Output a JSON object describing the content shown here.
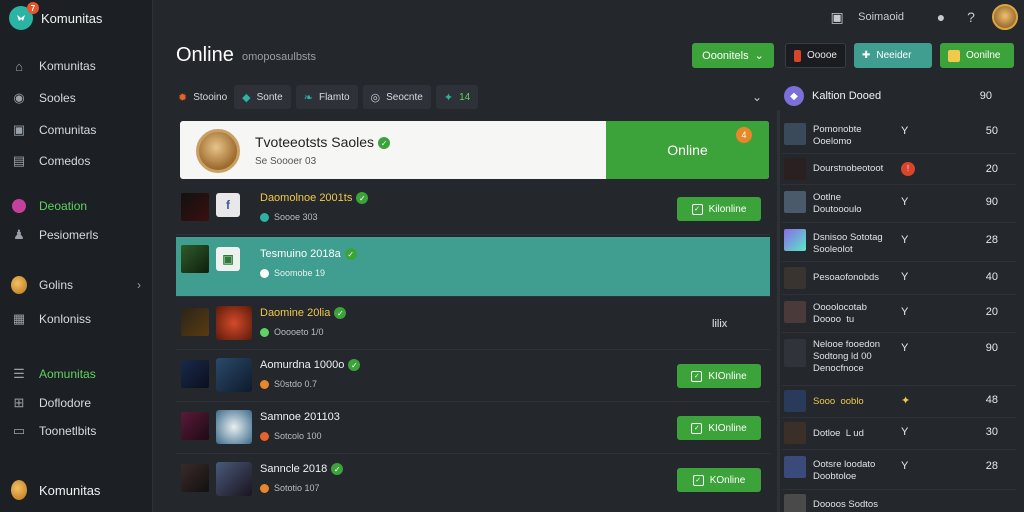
{
  "brand": {
    "name": "Komunitas",
    "badge": "7"
  },
  "sidebar": {
    "items": [
      {
        "label": "Komunitas",
        "icon": "home-icon"
      },
      {
        "label": "Sooles",
        "icon": "circle-icon"
      },
      {
        "label": "Comunitas",
        "icon": "lock-icon"
      },
      {
        "label": "Comedos",
        "icon": "blocks-icon"
      },
      {
        "label": "Deoation",
        "icon": "badge-icon"
      },
      {
        "label": "Pesiomerls",
        "icon": "user-icon"
      },
      {
        "label": "Golins",
        "icon": "avatar-icon"
      },
      {
        "label": "Konloniss",
        "icon": "chat-icon"
      },
      {
        "label": "Aomunitas",
        "icon": "list-icon"
      },
      {
        "label": "Doflodore",
        "icon": "grid-icon"
      },
      {
        "label": "Toonetlbits",
        "icon": "controller-icon"
      },
      {
        "label": "Komunitas",
        "icon": "avatar-icon"
      }
    ]
  },
  "topbar": {
    "label": "Soimaoid"
  },
  "main": {
    "title": "Online",
    "subtitle": "omoposaulbsts",
    "primary_button": "Ooonitels",
    "filters": [
      {
        "label": "Stooino",
        "icon": "flame-icon"
      },
      {
        "label": "Sonte",
        "icon": "diamond-icon"
      },
      {
        "label": "Flamto",
        "icon": "leaf-icon"
      },
      {
        "label": "Seocnte",
        "icon": "globe-icon"
      },
      {
        "label": "14",
        "icon": "sparkle-icon"
      }
    ],
    "featured": {
      "title": "Tvoteeotsts Saoles",
      "sub": "Se Soooer 03",
      "action": "Online",
      "badge": "4"
    },
    "rows": [
      {
        "name": "Daomolnoe 2001ts",
        "meta": "Soooe 303",
        "action": "Kilonline",
        "status": ""
      },
      {
        "name": "Tesmuino 2018a",
        "meta": "Soomobe 19",
        "action": "",
        "status": ""
      },
      {
        "name": "Daomine 20lia",
        "meta": "Ooooeto 1/0",
        "action": "",
        "status": "lilix"
      },
      {
        "name": "Aomurdna 1000o",
        "meta": "S0stdo 0.7",
        "action": "KIOnline",
        "status": ""
      },
      {
        "name": "Samnoe 201103",
        "meta": "Sotcolo 100",
        "action": "KIOnline",
        "status": ""
      },
      {
        "name": "Sanncle 2018",
        "meta": "Sototio 107",
        "action": "KOnline",
        "status": ""
      }
    ]
  },
  "right_panel": {
    "buttons": [
      {
        "label": "Ooooe"
      },
      {
        "label": "Neeider"
      },
      {
        "label": "Oonilne"
      }
    ],
    "header": {
      "name": "Kaltion Dooed",
      "num": "90"
    },
    "rows": [
      {
        "name": "Pomonobte\nOoelomo",
        "num": "50"
      },
      {
        "name": "Dourstnobeotoot",
        "num": "20"
      },
      {
        "name": "Ootlne\nDoutoooulo",
        "num": "90"
      },
      {
        "name": "Dsnisoo Sototag\nSooleolot",
        "num": "28"
      },
      {
        "name": "Pesoaofonobds",
        "num": "40"
      },
      {
        "name": "Oooolocotab\nDoooo  tu",
        "num": "20"
      },
      {
        "name": "Nelooe fooedon\nSodtong ld 00\nDenocfnoce",
        "num": "90"
      },
      {
        "name": "Sooo  ooblo",
        "num": "48"
      },
      {
        "name": "Dotloe  L ud",
        "num": "30"
      },
      {
        "name": "Ootsre loodato\nDoobtoloe",
        "num": "28"
      },
      {
        "name": "Doooos Sodtos",
        "num": ""
      }
    ]
  }
}
